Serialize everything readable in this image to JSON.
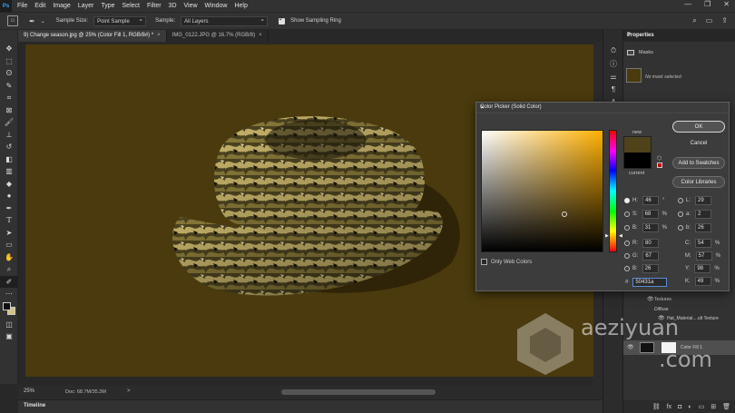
{
  "menubar": {
    "items": [
      "File",
      "Edit",
      "Image",
      "Layer",
      "Type",
      "Select",
      "Filter",
      "3D",
      "View",
      "Window",
      "Help"
    ]
  },
  "options": {
    "sample_size_label": "Sample Size:",
    "sample_size_value": "Point Sample",
    "sample_label": "Sample:",
    "sample_value": "All Layers",
    "show_ring_label": "Show Sampling Ring"
  },
  "tabs": [
    {
      "label": "9) Change season.jpg @ 25% (Color Fill 1, RGB/8#) *",
      "close": "×"
    },
    {
      "label": "IMG_0122.JPG @ 16.7% (RGB/8)",
      "close": "×"
    }
  ],
  "status": {
    "zoom": "25%",
    "doc": "Doc: 68.7M/35.3M",
    "arrow": ">"
  },
  "timeline": {
    "label": "Timeline"
  },
  "properties": {
    "title": "Properties",
    "masks_label": "Masks",
    "no_mask_note": "No mask selected"
  },
  "layers": {
    "textures": "Textures",
    "diffuse": "Diffuse",
    "hat_material": "Hat_Material....ult Texture",
    "color_fill": "Color Fill 1"
  },
  "color_picker": {
    "title": "Color Picker (Solid Color)",
    "new_label": "new",
    "current_label": "current",
    "ok": "OK",
    "cancel": "Cancel",
    "add_swatches": "Add to Swatches",
    "color_libraries": "Color Libraries",
    "H": "46",
    "H_unit": "°",
    "S": "68",
    "S_unit": "%",
    "B": "31",
    "B_unit": "%",
    "R": "80",
    "G": "67",
    "Bl": "26",
    "L": "29",
    "a": "2",
    "b": "26",
    "C": "54",
    "M": "57",
    "Y": "98",
    "K": "49",
    "pct": "%",
    "only_web": "Only Web Colors",
    "hex": "50431a",
    "new_color": "#50431a",
    "current_color": "#000000"
  },
  "watermark": {
    "line1": "aeziyuan",
    "line2": ".com"
  },
  "colors": {
    "canvas_bg": "#4a3a0d",
    "panel_bg": "#323232",
    "dialog_bg": "#3c3c3c"
  }
}
